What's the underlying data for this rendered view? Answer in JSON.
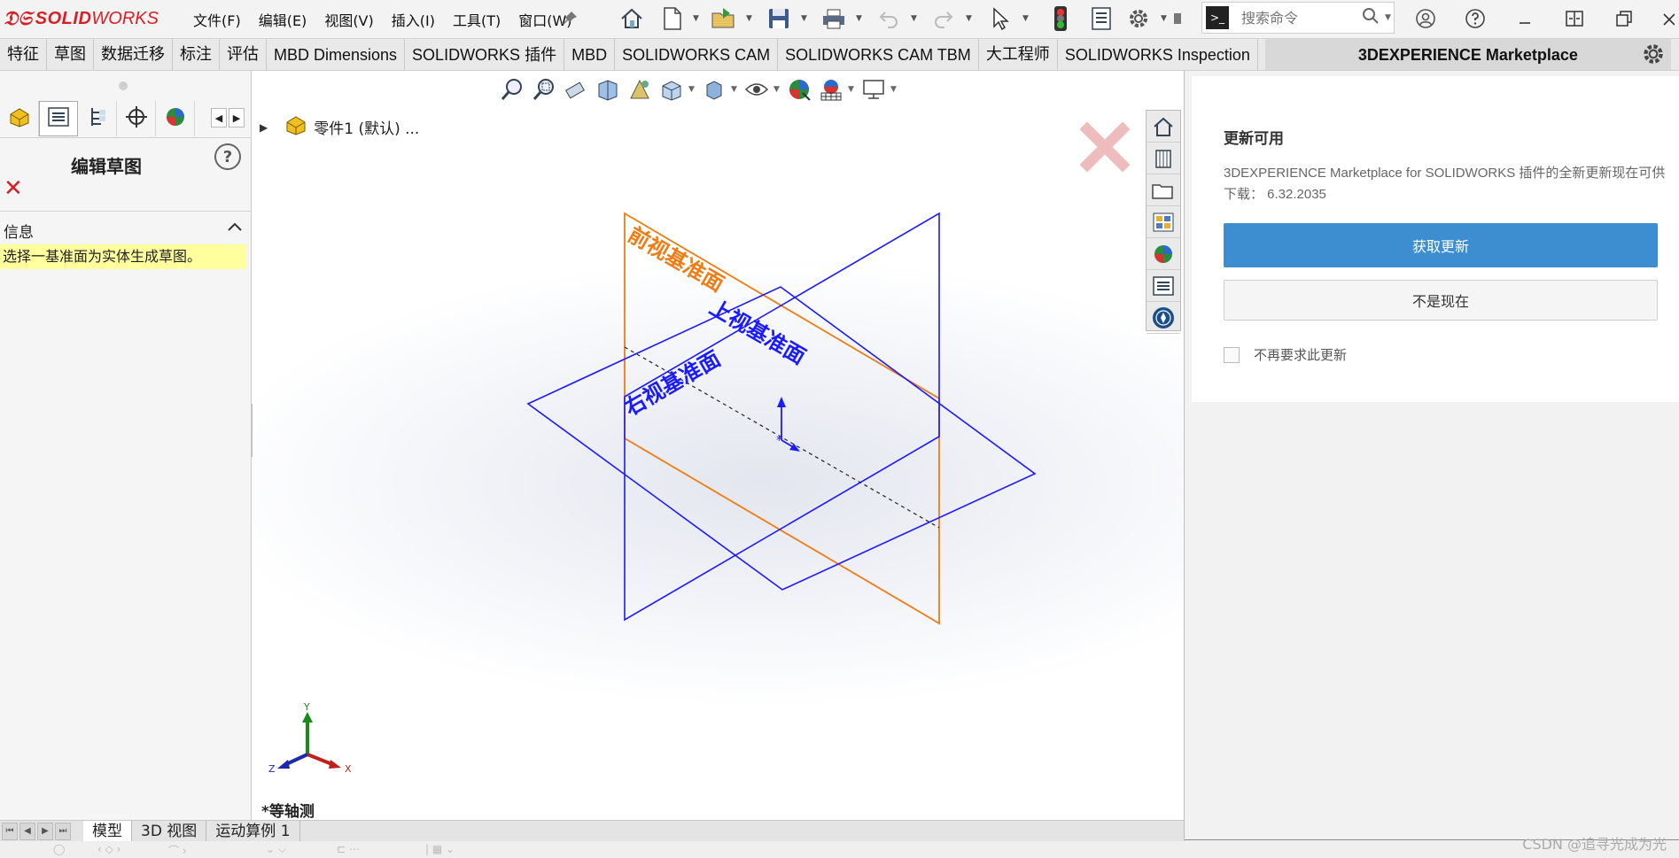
{
  "app": {
    "logo_brand": "SOLID",
    "logo_brand2": "WORKS",
    "menus": [
      "文件(F)",
      "编辑(E)",
      "视图(V)",
      "插入(I)",
      "工具(T)",
      "窗口(W)"
    ],
    "search_placeholder": "搜索命令"
  },
  "command_tabs": [
    "特征",
    "草图",
    "数据迁移",
    "标注",
    "评估",
    "MBD Dimensions",
    "SOLIDWORKS 插件",
    "MBD",
    "SOLIDWORKS CAM",
    "SOLIDWORKS CAM TBM",
    "大工程师",
    "SOLIDWORKS Inspection"
  ],
  "active_tab": "3DEXPERIENCE Marketplace",
  "property_manager": {
    "title": "编辑草图",
    "help": "?",
    "close": "✕",
    "info_header": "信息",
    "info_message": "选择一基准面为实体生成草图。"
  },
  "graphics": {
    "tree_root": "零件1 (默认) ...",
    "view_name": "*等轴测",
    "planes": {
      "front": "前视基准面",
      "top": "上视基准面",
      "right": "右视基准面"
    },
    "triad": {
      "x": "X",
      "y": "Y",
      "z": "Z"
    }
  },
  "update_panel": {
    "title": "更新可用",
    "description": "3DEXPERIENCE Marketplace for SOLIDWORKS 插件的全新更新现在可供下载：  6.32.2035",
    "primary_button": "获取更新",
    "secondary_button": "不是现在",
    "checkbox_label": "不再要求此更新"
  },
  "bottom_tabs": [
    "模型",
    "3D 视图",
    "运动算例 1"
  ],
  "active_bottom_tab": "模型",
  "watermark": "CSDN @追寻光成为光",
  "colors": {
    "brand_red": "#d71f26",
    "front_plane": "#f07c14",
    "plane_blue": "#1a1aff",
    "primary_button": "#3d8ed0",
    "info_highlight": "#ffff9e"
  }
}
